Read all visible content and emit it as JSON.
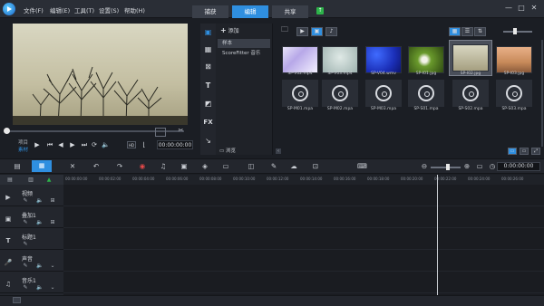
{
  "menu": [
    "文件(F)",
    "编辑(E)",
    "工具(T)",
    "设置(S)",
    "帮助(H)"
  ],
  "tabs": {
    "capture": "捕获",
    "edit": "编辑",
    "share": "共享"
  },
  "window": {
    "minimize": "—",
    "maximize": "□",
    "close": "✕"
  },
  "player": {
    "project_label": "项目",
    "clip_label": "素材",
    "timecode": "00:00:00:00",
    "scrub_position": 0.0
  },
  "library": {
    "add_label": "添加",
    "categories": [
      "样本",
      "ScoreFitter 音乐"
    ],
    "browse_label": "浏览",
    "items": [
      {
        "name": "SP-V02.mp4",
        "kind": "video"
      },
      {
        "name": "SP-V03.mp4",
        "kind": "video"
      },
      {
        "name": "SP-V04.wmv",
        "kind": "video"
      },
      {
        "name": "SP-I01.jpg",
        "kind": "image"
      },
      {
        "name": "SP-I02.jpg",
        "kind": "image",
        "selected": true
      },
      {
        "name": "SP-I03.jpg",
        "kind": "image"
      },
      {
        "name": "SP-M01.mpa",
        "kind": "audio"
      },
      {
        "name": "SP-M02.mpa",
        "kind": "audio"
      },
      {
        "name": "SP-M03.mpa",
        "kind": "audio"
      },
      {
        "name": "SP-S01.mpa",
        "kind": "audio"
      },
      {
        "name": "SP-S02.mpa",
        "kind": "audio"
      },
      {
        "name": "SP-S03.mpa",
        "kind": "audio"
      }
    ]
  },
  "timeline": {
    "time": "0:00:00:00",
    "ruler": [
      "00:00:00:00",
      "00:00:02:00",
      "00:00:04:00",
      "00:00:06:00",
      "00:00:08:00",
      "00:00:10:00",
      "00:00:12:00",
      "00:00:14:00",
      "00:00:16:00",
      "00:00:18:00",
      "00:00:20:00",
      "00:00:22:00",
      "00:00:24:00",
      "00:00:26:00"
    ],
    "tracks": [
      "视频",
      "叠加1",
      "标题1",
      "声音",
      "音乐1"
    ]
  },
  "colors": {
    "accent": "#2f8fe0",
    "share_upload": "#2db34a"
  }
}
